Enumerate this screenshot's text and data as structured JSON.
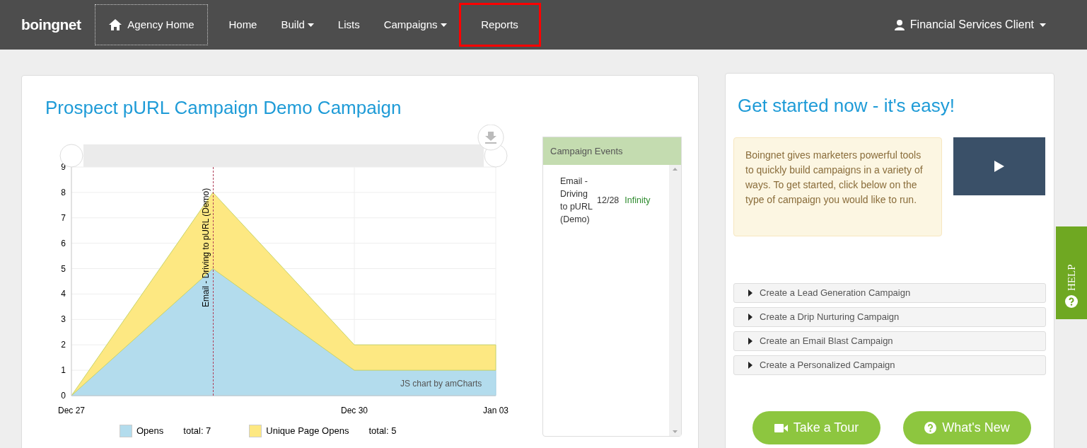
{
  "nav": {
    "logo": "boingnet",
    "agency_home": "Agency Home",
    "items": [
      {
        "label": "Home",
        "dropdown": false,
        "highlighted": false
      },
      {
        "label": "Build",
        "dropdown": true,
        "highlighted": false
      },
      {
        "label": "Lists",
        "dropdown": false,
        "highlighted": false
      },
      {
        "label": "Campaigns",
        "dropdown": true,
        "highlighted": false
      },
      {
        "label": "Reports",
        "dropdown": false,
        "highlighted": true
      }
    ],
    "user": "Financial Services Client"
  },
  "report": {
    "title": "Prospect pURL Campaign Demo Campaign",
    "chart_data": {
      "type": "area",
      "stacked": true,
      "categories": [
        "Dec 27",
        null,
        "Dec 30",
        "Jan 03"
      ],
      "ylim": [
        0,
        9
      ],
      "yticks": [
        0,
        1,
        2,
        3,
        4,
        5,
        6,
        7,
        8,
        9
      ],
      "series": [
        {
          "name": "Opens",
          "color": "#b3dced",
          "values": [
            0,
            5,
            1,
            1
          ]
        },
        {
          "name": "Unique Page Opens",
          "color": "#fde882",
          "values": [
            0,
            3,
            1,
            1
          ]
        }
      ],
      "grid": true,
      "annotations": [
        "Email - Driving to pURL (Demo)"
      ]
    },
    "credit": "JS chart by amCharts",
    "legend_totals": [
      "total: 7",
      "total: 5"
    ],
    "events": {
      "title": "Campaign Events",
      "rows": [
        {
          "name": "Email - Driving to pURL (Demo)",
          "date": "12/28",
          "value": "Infinity"
        }
      ]
    }
  },
  "get_started": {
    "title": "Get started now - it's easy!",
    "intro": "Boingnet gives marketers powerful tools to quickly build campaigns in a variety of ways. To get started, click below on the type of campaign you would like to run.",
    "options": [
      {
        "label": "Create a Lead Generation Campaign",
        "expanded": false
      },
      {
        "label": "Create a Drip Nurturing Campaign",
        "expanded": false
      },
      {
        "label": "Create an Email Blast Campaign",
        "expanded": false
      },
      {
        "label": "Create a Personalized Campaign",
        "expanded": false
      }
    ],
    "buttons": [
      {
        "label": "Take a Tour",
        "kind": "video"
      },
      {
        "label": "What's New",
        "kind": "question"
      }
    ]
  },
  "help_tab": "HELP"
}
